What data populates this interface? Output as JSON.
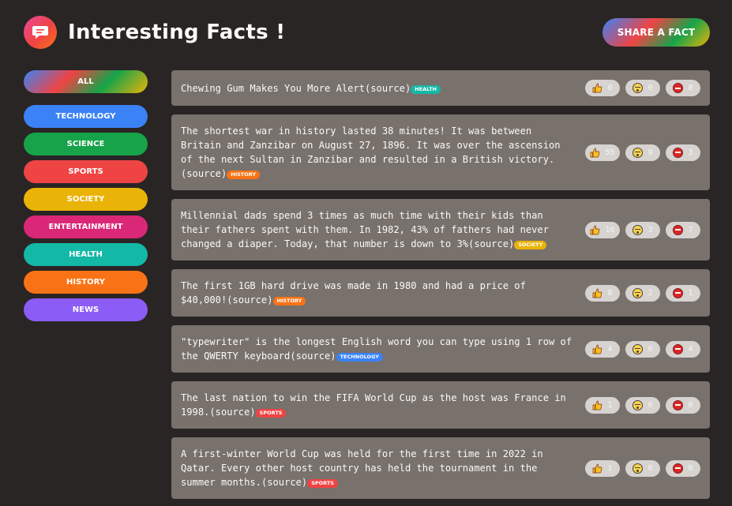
{
  "header": {
    "title": "Interesting Facts !",
    "share_label": "SHARE A FACT"
  },
  "categories": [
    {
      "label": "ALL",
      "color": "gradient"
    },
    {
      "label": "TECHNOLOGY",
      "color": "#3b82f6"
    },
    {
      "label": "SCIENCE",
      "color": "#16a34a"
    },
    {
      "label": "SPORTS",
      "color": "#ef4444"
    },
    {
      "label": "SOCIETY",
      "color": "#eab308"
    },
    {
      "label": "ENTERTAINMENT",
      "color": "#db2777"
    },
    {
      "label": "HEALTH",
      "color": "#14b8a6"
    },
    {
      "label": "HISTORY",
      "color": "#f97316"
    },
    {
      "label": "NEWS",
      "color": "#8b5cf6"
    }
  ],
  "facts": [
    {
      "text": "Chewing Gum Makes You More Alert",
      "source": "(source)",
      "tag": "HEALTH",
      "tag_color": "#14b8a6",
      "interesting": "0",
      "mindblowing": "0",
      "false": "0"
    },
    {
      "text": "The shortest war in history lasted 38 minutes! It was between Britain and Zanzibar on August 27, 1896. It was over the ascension of the next Sultan in Zanzibar and resulted in a British victory.",
      "source": "(source)",
      "tag": "HISTORY",
      "tag_color": "#f97316",
      "interesting": "55",
      "mindblowing": "9",
      "false": "3"
    },
    {
      "text": "Millennial dads spend 3 times as much time with their kids than their fathers spent with them. In 1982, 43% of fathers had never changed a diaper. Today, that number is down to 3%",
      "source": "(source)",
      "tag": "SOCIETY",
      "tag_color": "#eab308",
      "interesting": "16",
      "mindblowing": "3",
      "false": "7"
    },
    {
      "text": "The first 1GB hard drive was made in 1980 and had a price of $40,000!",
      "source": "(source)",
      "tag": "HISTORY",
      "tag_color": "#f97316",
      "interesting": "8",
      "mindblowing": "2",
      "false": "1"
    },
    {
      "text": "\"typewriter\" is the longest English word you can type using 1 row of the QWERTY keyboard",
      "source": "(source)",
      "tag": "TECHNOLOGY",
      "tag_color": "#3b82f6",
      "interesting": "4",
      "mindblowing": "0",
      "false": "4"
    },
    {
      "text": "The last nation to win the FIFA World Cup as the host was France in 1998.",
      "source": "(source)",
      "tag": "SPORTS",
      "tag_color": "#ef4444",
      "interesting": "1",
      "mindblowing": "0",
      "false": "0"
    },
    {
      "text": "A first-winter World Cup was held for the first time in 2022 in Qatar. Every other host country has held the tournament in the summer months.",
      "source": "(source)",
      "tag": "SPORTS",
      "tag_color": "#ef4444",
      "interesting": "1",
      "mindblowing": "0",
      "false": "0"
    }
  ],
  "icons": {
    "logo": "chat-bubble-icon",
    "interesting": "thumbs-up-icon",
    "mindblowing": "mind-blown-icon",
    "false": "no-entry-icon"
  }
}
